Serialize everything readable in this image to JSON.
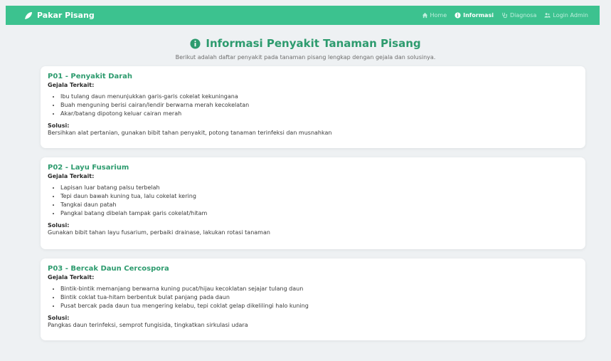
{
  "nav": {
    "brand": "Pakar Pisang",
    "items": [
      {
        "label": "Home",
        "icon": "home-icon"
      },
      {
        "label": "Informasi",
        "icon": "info-icon"
      },
      {
        "label": "Diagnosa",
        "icon": "stethoscope-icon"
      },
      {
        "label": "Login Admin",
        "icon": "users-icon"
      }
    ]
  },
  "header": {
    "title": "Informasi Penyakit Tanaman Pisang",
    "subtitle": "Berikut adalah daftar penyakit pada tanaman pisang lengkap dengan gejala dan solusinya."
  },
  "labels": {
    "gejala": "Gejala Terkait:",
    "solusi": "Solusi:"
  },
  "diseases": [
    {
      "title": "P01 - Penyakit Darah",
      "symptoms": [
        "Ibu tulang daun menunjukkan garis-garis cokelat kekuningana",
        "Buah menguning berisi cairan/lendir berwarna merah kecokelatan",
        "Akar/batang dipotong keluar cairan merah"
      ],
      "solution": "Bersihkan alat pertanian, gunakan bibit tahan penyakit, potong tanaman terinfeksi dan musnahkan"
    },
    {
      "title": "P02 - Layu Fusarium",
      "symptoms": [
        "Lapisan luar batang palsu terbelah",
        "Tepi daun bawah kuning tua, lalu cokelat kering",
        "Tangkai daun patah",
        "Pangkal batang dibelah tampak garis cokelat/hitam"
      ],
      "solution": "Gunakan bibit tahan layu fusarium, perbaiki drainase, lakukan rotasi tanaman"
    },
    {
      "title": "P03 - Bercak Daun Cercospora",
      "symptoms": [
        "Bintik-bintik memanjang berwarna kuning pucat/hijau kecoklatan sejajar tulang daun",
        "Bintik coklat tua-hitam berbentuk bulat panjang pada daun",
        "Pusat bercak pada daun tua mengering kelabu, tepi coklat gelap dikelilingi halo kuning"
      ],
      "solution": "Pangkas daun terinfeksi, semprot fungisida, tingkatkan sirkulasi udara"
    }
  ],
  "colors": {
    "primary": "#3cc28f",
    "heading": "#2d9b6e",
    "background": "#eef1f3"
  }
}
